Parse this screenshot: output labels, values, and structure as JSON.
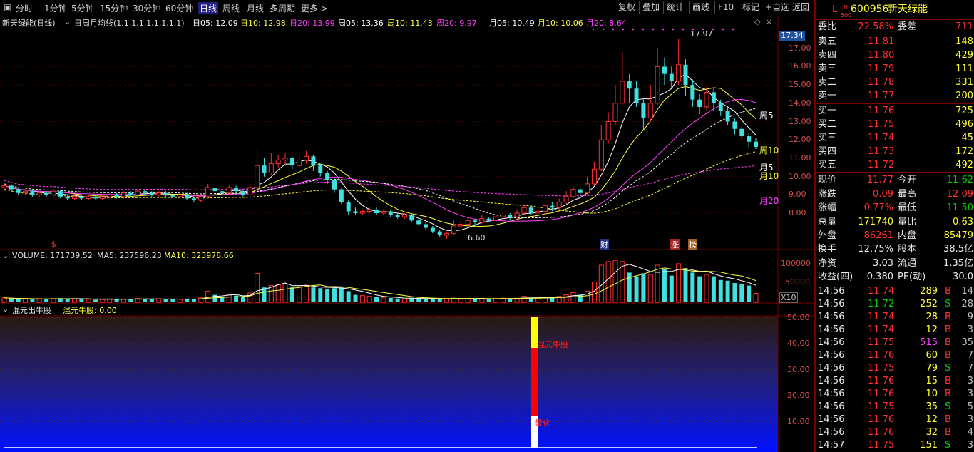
{
  "toolbar": {
    "periods": [
      "分时",
      "1分钟",
      "5分钟",
      "15分钟",
      "30分钟",
      "60分钟",
      "日线",
      "周线",
      "月线",
      "多周期",
      "更多 >"
    ],
    "active": "日线",
    "buttons": [
      "复权",
      "叠加",
      "统计",
      "画线",
      "F10",
      "标记",
      "+自选",
      "返回"
    ]
  },
  "chart_header": {
    "stock": "新天绿能(日线)",
    "indicator": "日周月均线(1,1,1,1,1,1,1,1,1)",
    "ma": [
      {
        "label": "日05: 12.09",
        "color": "#ffffff"
      },
      {
        "label": "日10: 12.98",
        "color": "#ffff40"
      },
      {
        "label": "日20: 13.99",
        "color": "#ff40ff"
      },
      {
        "label": "周05: 13.36",
        "color": "#ffffff"
      },
      {
        "label": "周10: 11.43",
        "color": "#ffff40"
      },
      {
        "label": "周20: 9.97",
        "color": "#ff40ff"
      },
      {
        "label": "月05: 10.49",
        "color": "#ffffff"
      },
      {
        "label": "月10: 10.06",
        "color": "#ffff40"
      },
      {
        "label": "月20: 8.64",
        "color": "#ff40ff"
      }
    ]
  },
  "price_axis": {
    "current": "17.34",
    "ticks": [
      "17.00",
      "16.00",
      "15.00",
      "14.00",
      "13.00",
      "12.00",
      "11.00",
      "10.00",
      "9.00",
      "8.00"
    ]
  },
  "annotations": {
    "high": "17.97",
    "low": "6.60",
    "line_labels": [
      "周5",
      "周10",
      "月5",
      "月10",
      "月20"
    ],
    "events": [
      "财",
      "涨",
      "榜"
    ],
    "marker": "$"
  },
  "volume": {
    "header": "VOLUME: 171739.52",
    "ma5": "MA5: 237596.23",
    "ma10": "MA10: 323978.66",
    "ticks": [
      "100000",
      "50000"
    ],
    "unit": "X10"
  },
  "indicator2": {
    "name": "混元出牛股",
    "value": "混元牛股: 0.00",
    "ticks": [
      "50.00",
      "40.00",
      "30.00",
      "20.00",
      "10.00"
    ],
    "bar_label_top": "混元牛股",
    "bar_label_bottom": "量化"
  },
  "quote": {
    "flag": "L",
    "flag_sup": "N",
    "flag_sub": "500",
    "code": "600956",
    "name": "新天绿能",
    "weibi_label": "委比",
    "weibi": "22.58%",
    "weicha_label": "委差",
    "weicha": "711",
    "asks": [
      {
        "label": "卖五",
        "price": "11.81",
        "vol": "148"
      },
      {
        "label": "卖四",
        "price": "11.80",
        "vol": "429"
      },
      {
        "label": "卖三",
        "price": "11.79",
        "vol": "111"
      },
      {
        "label": "卖二",
        "price": "11.78",
        "vol": "331"
      },
      {
        "label": "卖一",
        "price": "11.77",
        "vol": "200"
      }
    ],
    "bids": [
      {
        "label": "买一",
        "price": "11.76",
        "vol": "725"
      },
      {
        "label": "买二",
        "price": "11.75",
        "vol": "496"
      },
      {
        "label": "买三",
        "price": "11.74",
        "vol": "45"
      },
      {
        "label": "买四",
        "price": "11.73",
        "vol": "172"
      },
      {
        "label": "买五",
        "price": "11.72",
        "vol": "492"
      }
    ],
    "stats": [
      {
        "l1": "现价",
        "v1": "11.77",
        "c1": "red",
        "l2": "今开",
        "v2": "11.62",
        "c2": "green"
      },
      {
        "l1": "涨跌",
        "v1": "0.09",
        "c1": "red",
        "l2": "最高",
        "v2": "12.09",
        "c2": "red"
      },
      {
        "l1": "涨幅",
        "v1": "0.77%",
        "c1": "red",
        "l2": "最低",
        "v2": "11.50",
        "c2": "green"
      },
      {
        "l1": "总量",
        "v1": "171740",
        "c1": "yellow",
        "l2": "量比",
        "v2": "0.63",
        "c2": "yellow"
      },
      {
        "l1": "外盘",
        "v1": "86261",
        "c1": "red",
        "l2": "内盘",
        "v2": "85479",
        "c2": "yellow"
      }
    ],
    "stats2": [
      {
        "l1": "换手",
        "v1": "12.75%",
        "l2": "股本",
        "v2": "38.5亿"
      },
      {
        "l1": "净资",
        "v1": "3.03",
        "l2": "流通",
        "v2": "1.35亿"
      },
      {
        "l1": "收益(四)",
        "v1": "0.380",
        "l2": "PE(动)",
        "v2": "30.0"
      }
    ]
  },
  "ticks": [
    {
      "time": "14:56",
      "price": "11.74",
      "vol": "289",
      "bs": "B",
      "n": "14"
    },
    {
      "time": "14:56",
      "price": "11.72",
      "vol": "252",
      "bs": "S",
      "n": "28"
    },
    {
      "time": "14:56",
      "price": "11.74",
      "vol": "28",
      "bs": "B",
      "n": "9"
    },
    {
      "time": "14:56",
      "price": "11.74",
      "vol": "12",
      "bs": "B",
      "n": "3"
    },
    {
      "time": "14:56",
      "price": "11.75",
      "vol": "515",
      "bs": "B",
      "n": "35"
    },
    {
      "time": "14:56",
      "price": "11.76",
      "vol": "60",
      "bs": "B",
      "n": "7"
    },
    {
      "time": "14:56",
      "price": "11.75",
      "vol": "79",
      "bs": "S",
      "n": "7"
    },
    {
      "time": "14:56",
      "price": "11.76",
      "vol": "15",
      "bs": "B",
      "n": "3"
    },
    {
      "time": "14:56",
      "price": "11.76",
      "vol": "10",
      "bs": "B",
      "n": "3"
    },
    {
      "time": "14:56",
      "price": "11.75",
      "vol": "35",
      "bs": "S",
      "n": "5"
    },
    {
      "time": "14:56",
      "price": "11.76",
      "vol": "12",
      "bs": "B",
      "n": "3"
    },
    {
      "time": "14:56",
      "price": "11.76",
      "vol": "32",
      "bs": "B",
      "n": "4"
    },
    {
      "time": "14:57",
      "price": "11.75",
      "vol": "151",
      "bs": "S",
      "n": "3"
    }
  ],
  "candles": [
    [
      9.4,
      9.5,
      9.6,
      9.2
    ],
    [
      9.5,
      9.3,
      9.6,
      9.2
    ],
    [
      9.3,
      9.1,
      9.4,
      9.0
    ],
    [
      9.1,
      9.2,
      9.3,
      9.0
    ],
    [
      9.2,
      9.0,
      9.3,
      8.9
    ],
    [
      9.0,
      9.1,
      9.2,
      8.9
    ],
    [
      9.1,
      9.0,
      9.2,
      8.9
    ],
    [
      9.0,
      9.2,
      9.3,
      8.9
    ],
    [
      9.2,
      8.9,
      9.3,
      8.8
    ],
    [
      8.9,
      8.8,
      9.0,
      8.7
    ],
    [
      8.8,
      8.9,
      9.0,
      8.7
    ],
    [
      8.9,
      8.8,
      9.0,
      8.7
    ],
    [
      8.8,
      8.9,
      9.0,
      8.7
    ],
    [
      8.9,
      8.8,
      9.0,
      8.7
    ],
    [
      8.8,
      8.9,
      9.0,
      8.7
    ],
    [
      8.9,
      9.0,
      9.1,
      8.8
    ],
    [
      9.0,
      8.9,
      9.1,
      8.8
    ],
    [
      8.9,
      9.1,
      9.2,
      8.8
    ],
    [
      9.1,
      9.0,
      9.2,
      8.9
    ],
    [
      9.0,
      9.2,
      9.3,
      8.9
    ],
    [
      9.2,
      9.1,
      9.3,
      9.0
    ],
    [
      9.1,
      9.0,
      9.2,
      8.9
    ],
    [
      9.0,
      9.1,
      9.2,
      8.9
    ],
    [
      9.1,
      9.0,
      9.2,
      8.9
    ],
    [
      9.0,
      8.9,
      9.1,
      8.8
    ],
    [
      8.9,
      9.0,
      9.1,
      8.8
    ],
    [
      9.0,
      8.8,
      9.1,
      8.7
    ],
    [
      8.8,
      8.7,
      8.9,
      8.6
    ],
    [
      8.7,
      8.9,
      9.0,
      8.6
    ],
    [
      8.9,
      9.4,
      9.6,
      8.8
    ],
    [
      9.4,
      9.2,
      9.5,
      9.1
    ],
    [
      9.2,
      9.1,
      9.3,
      9.0
    ],
    [
      9.1,
      9.4,
      9.5,
      9.0
    ],
    [
      9.4,
      9.2,
      9.5,
      9.0
    ],
    [
      9.2,
      9.0,
      9.3,
      8.9
    ],
    [
      9.0,
      9.4,
      9.6,
      8.9
    ],
    [
      9.4,
      10.6,
      11.6,
      9.3
    ],
    [
      10.6,
      10.2,
      11.0,
      10.0
    ],
    [
      10.2,
      10.7,
      11.3,
      10.1
    ],
    [
      10.7,
      10.9,
      11.2,
      10.5
    ],
    [
      10.9,
      11.0,
      11.3,
      10.6
    ],
    [
      11.0,
      10.6,
      11.1,
      10.4
    ],
    [
      10.6,
      10.9,
      11.2,
      10.5
    ],
    [
      10.9,
      11.1,
      11.4,
      10.7
    ],
    [
      11.1,
      10.6,
      11.2,
      10.3
    ],
    [
      10.6,
      10.2,
      10.7,
      10.0
    ],
    [
      10.2,
      9.8,
      10.3,
      9.6
    ],
    [
      9.8,
      9.3,
      9.9,
      9.1
    ],
    [
      9.3,
      8.6,
      9.4,
      8.5
    ],
    [
      8.6,
      8.1,
      8.7,
      7.9
    ],
    [
      8.1,
      8.0,
      8.3,
      7.9
    ],
    [
      8.0,
      8.1,
      8.2,
      7.9
    ],
    [
      8.1,
      8.2,
      8.3,
      8.0
    ],
    [
      8.2,
      8.0,
      8.3,
      7.9
    ],
    [
      8.0,
      8.1,
      8.2,
      7.9
    ],
    [
      8.1,
      7.9,
      8.2,
      7.8
    ],
    [
      7.9,
      7.8,
      8.0,
      7.7
    ],
    [
      7.8,
      7.9,
      8.0,
      7.7
    ],
    [
      7.9,
      7.6,
      8.0,
      7.5
    ],
    [
      7.6,
      7.4,
      7.7,
      7.3
    ],
    [
      7.4,
      7.2,
      7.5,
      7.1
    ],
    [
      7.2,
      7.0,
      7.3,
      6.9
    ],
    [
      7.0,
      6.8,
      7.1,
      6.7
    ],
    [
      6.8,
      6.9,
      7.0,
      6.6
    ],
    [
      6.9,
      7.3,
      7.6,
      6.8
    ],
    [
      7.3,
      7.4,
      7.6,
      7.2
    ],
    [
      7.4,
      7.6,
      7.8,
      7.3
    ],
    [
      7.6,
      7.5,
      7.7,
      7.3
    ],
    [
      7.5,
      7.7,
      7.9,
      7.4
    ],
    [
      7.7,
      7.6,
      7.8,
      7.5
    ],
    [
      7.6,
      7.8,
      8.0,
      7.5
    ],
    [
      7.8,
      7.9,
      8.1,
      7.7
    ],
    [
      7.9,
      7.8,
      8.0,
      7.6
    ],
    [
      7.8,
      8.0,
      8.2,
      7.7
    ],
    [
      8.0,
      8.3,
      8.5,
      7.9
    ],
    [
      8.3,
      8.0,
      8.4,
      7.9
    ],
    [
      8.0,
      8.1,
      8.3,
      7.9
    ],
    [
      8.1,
      8.4,
      8.6,
      8.0
    ],
    [
      8.4,
      8.3,
      8.6,
      8.1
    ],
    [
      8.3,
      8.6,
      8.8,
      8.2
    ],
    [
      8.6,
      8.9,
      9.2,
      8.5
    ],
    [
      8.9,
      9.3,
      9.5,
      8.8
    ],
    [
      9.3,
      9.1,
      9.4,
      8.9
    ],
    [
      9.1,
      9.6,
      10.0,
      9.0
    ],
    [
      9.6,
      10.4,
      10.8,
      9.5
    ],
    [
      10.4,
      12.0,
      12.8,
      10.3
    ],
    [
      12.0,
      13.0,
      13.5,
      11.8
    ],
    [
      13.0,
      14.0,
      15.0,
      12.8
    ],
    [
      14.0,
      15.2,
      16.8,
      13.9
    ],
    [
      15.2,
      14.8,
      15.6,
      14.0
    ],
    [
      14.8,
      14.0,
      15.2,
      13.8
    ],
    [
      14.0,
      13.2,
      14.2,
      12.5
    ],
    [
      13.2,
      14.0,
      15.0,
      13.0
    ],
    [
      14.0,
      16.0,
      17.0,
      13.9
    ],
    [
      16.0,
      15.6,
      16.5,
      15.0
    ],
    [
      15.6,
      15.2,
      16.0,
      14.8
    ],
    [
      15.2,
      16.1,
      17.5,
      15.0
    ],
    [
      16.1,
      15.0,
      16.4,
      14.4
    ],
    [
      15.0,
      14.2,
      15.3,
      13.8
    ],
    [
      14.2,
      13.8,
      14.5,
      13.4
    ],
    [
      13.8,
      14.6,
      14.9,
      13.6
    ],
    [
      14.6,
      14.0,
      14.8,
      13.6
    ],
    [
      14.0,
      13.6,
      14.2,
      13.3
    ],
    [
      13.6,
      13.0,
      13.8,
      12.8
    ],
    [
      13.0,
      12.6,
      13.2,
      12.3
    ],
    [
      12.6,
      12.2,
      12.8,
      12.0
    ],
    [
      12.2,
      11.9,
      12.4,
      11.6
    ],
    [
      11.9,
      11.62,
      12.09,
      11.5
    ]
  ],
  "volumes": [
    [
      12,
      1
    ],
    [
      10,
      0
    ],
    [
      9,
      0
    ],
    [
      9,
      1
    ],
    [
      8,
      0
    ],
    [
      8,
      1
    ],
    [
      9,
      0
    ],
    [
      10,
      1
    ],
    [
      11,
      0
    ],
    [
      10,
      0
    ],
    [
      9,
      1
    ],
    [
      8,
      0
    ],
    [
      8,
      1
    ],
    [
      7,
      0
    ],
    [
      8,
      1
    ],
    [
      9,
      1
    ],
    [
      8,
      0
    ],
    [
      9,
      1
    ],
    [
      9,
      0
    ],
    [
      10,
      1
    ],
    [
      9,
      0
    ],
    [
      8,
      0
    ],
    [
      9,
      1
    ],
    [
      8,
      0
    ],
    [
      9,
      0
    ],
    [
      8,
      1
    ],
    [
      8,
      0
    ],
    [
      9,
      0
    ],
    [
      12,
      1
    ],
    [
      30,
      1
    ],
    [
      20,
      0
    ],
    [
      15,
      0
    ],
    [
      20,
      1
    ],
    [
      18,
      0
    ],
    [
      14,
      0
    ],
    [
      25,
      1
    ],
    [
      78,
      1
    ],
    [
      40,
      0
    ],
    [
      45,
      1
    ],
    [
      48,
      1
    ],
    [
      50,
      1
    ],
    [
      40,
      0
    ],
    [
      42,
      1
    ],
    [
      46,
      1
    ],
    [
      40,
      0
    ],
    [
      38,
      0
    ],
    [
      36,
      0
    ],
    [
      38,
      0
    ],
    [
      40,
      0
    ],
    [
      30,
      0
    ],
    [
      20,
      0
    ],
    [
      18,
      1
    ],
    [
      16,
      1
    ],
    [
      14,
      0
    ],
    [
      12,
      1
    ],
    [
      12,
      0
    ],
    [
      10,
      0
    ],
    [
      9,
      1
    ],
    [
      12,
      0
    ],
    [
      10,
      0
    ],
    [
      9,
      0
    ],
    [
      10,
      0
    ],
    [
      8,
      0
    ],
    [
      9,
      1
    ],
    [
      14,
      1
    ],
    [
      10,
      1
    ],
    [
      10,
      1
    ],
    [
      9,
      0
    ],
    [
      10,
      1
    ],
    [
      9,
      0
    ],
    [
      10,
      1
    ],
    [
      11,
      1
    ],
    [
      10,
      0
    ],
    [
      11,
      1
    ],
    [
      16,
      1
    ],
    [
      12,
      0
    ],
    [
      12,
      1
    ],
    [
      14,
      1
    ],
    [
      13,
      0
    ],
    [
      16,
      1
    ],
    [
      20,
      1
    ],
    [
      26,
      1
    ],
    [
      20,
      0
    ],
    [
      30,
      1
    ],
    [
      55,
      1
    ],
    [
      100,
      1
    ],
    [
      110,
      1
    ],
    [
      112,
      1
    ],
    [
      110,
      1
    ],
    [
      80,
      0
    ],
    [
      70,
      0
    ],
    [
      78,
      0
    ],
    [
      75,
      1
    ],
    [
      100,
      1
    ],
    [
      90,
      0
    ],
    [
      72,
      0
    ],
    [
      104,
      1
    ],
    [
      90,
      0
    ],
    [
      80,
      0
    ],
    [
      70,
      0
    ],
    [
      75,
      1
    ],
    [
      70,
      0
    ],
    [
      60,
      0
    ],
    [
      58,
      0
    ],
    [
      52,
      0
    ],
    [
      50,
      0
    ],
    [
      45,
      0
    ],
    [
      24,
      1
    ]
  ]
}
